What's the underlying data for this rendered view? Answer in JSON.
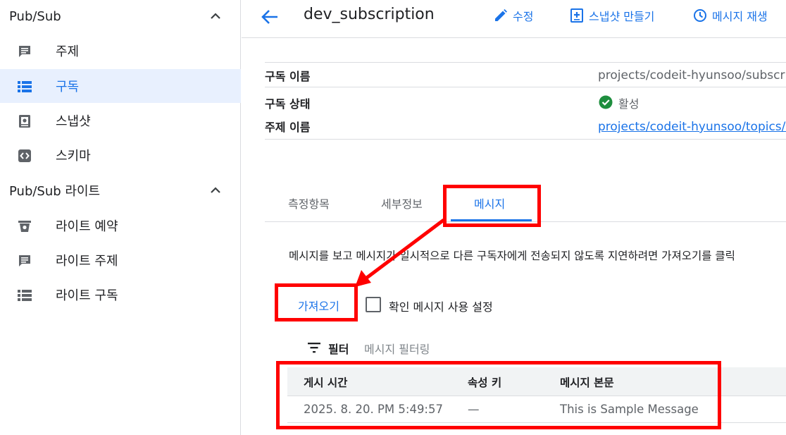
{
  "sidebar": {
    "sections": [
      {
        "title": "Pub/Sub",
        "items": [
          {
            "label": "주제",
            "icon": "topic-icon"
          },
          {
            "label": "구독",
            "icon": "subscription-list-icon",
            "active": true
          },
          {
            "label": "스냅샷",
            "icon": "snapshot-icon"
          },
          {
            "label": "스키마",
            "icon": "schema-icon"
          }
        ]
      },
      {
        "title": "Pub/Sub 라이트",
        "items": [
          {
            "label": "라이트 예약",
            "icon": "reservation-icon"
          },
          {
            "label": "라이트 주제",
            "icon": "topic-icon"
          },
          {
            "label": "라이트 구독",
            "icon": "subscription-list-icon"
          }
        ]
      }
    ]
  },
  "header": {
    "title": "dev_subscription",
    "edit_label": "수정",
    "snapshot_label": "스냅샷 만들기",
    "replay_label": "메시지 재생"
  },
  "details": {
    "rows": [
      {
        "label": "구독 이름",
        "value": "projects/codeit-hyunsoo/subscrip"
      },
      {
        "label": "구독 상태",
        "value": "활성"
      },
      {
        "label": "주제 이름",
        "value": "projects/codeit-hyunsoo/topics/d"
      }
    ]
  },
  "tabs": [
    {
      "label": "측정항목"
    },
    {
      "label": "세부정보"
    },
    {
      "label": "메시지",
      "active": true
    }
  ],
  "messages": {
    "description": "메시지를 보고 메시지가 일시적으로 다른 구독자에게 전송되지 않도록 지연하려면 가져오기를 클릭",
    "pull_label": "가져오기",
    "ack_checkbox_label": "확인 메시지 사용 설정",
    "filter_label": "필터",
    "filter_placeholder": "메시지 필터링",
    "columns": [
      "게시 시간",
      "속성 키",
      "메시지 본문"
    ],
    "rows": [
      {
        "publish_time": "2025. 8. 20. PM 5:49:57",
        "attribute_keys": "—",
        "body": "This is Sample Message"
      }
    ]
  },
  "colors": {
    "accent": "#1a73e8",
    "active_bg": "#e8f0fe",
    "annotation": "#ff0000",
    "status_ok": "#1e8e3e"
  }
}
